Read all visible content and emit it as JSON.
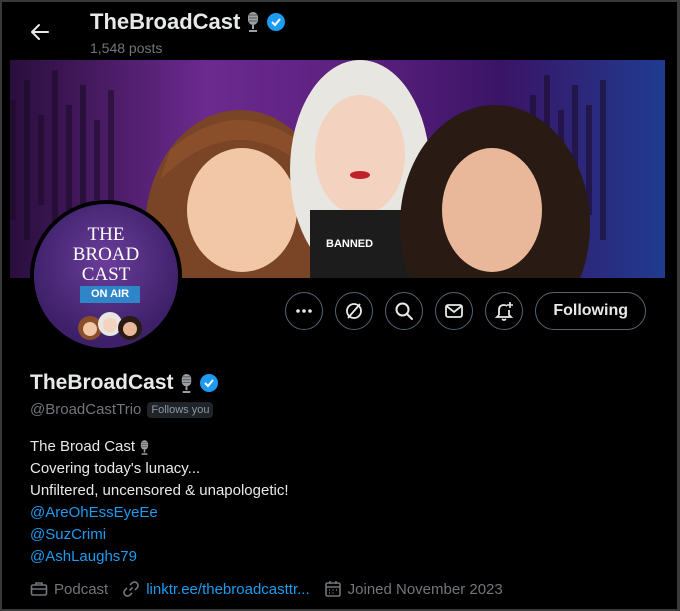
{
  "header": {
    "title": "TheBroadCast",
    "posts": "1,548 posts"
  },
  "banner": {
    "badge_text": "BANNED"
  },
  "avatar": {
    "line1": "THE",
    "line2": "BROAD",
    "line3": "CAST",
    "on_air": "ON AIR"
  },
  "actions": {
    "following_label": "Following"
  },
  "profile": {
    "name": "TheBroadCast",
    "handle": "@BroadCastTrio",
    "follows_you": "Follows you",
    "bio": {
      "line1": "The Broad Cast",
      "line2": "Covering today's lunacy...",
      "line3": "Unfiltered, uncensored & unapologetic!",
      "mentions": [
        "@AreOhEssEyeEe",
        "@SuzCrimi",
        "@AshLaughs79"
      ]
    },
    "meta": {
      "category": "Podcast",
      "link": "linktr.ee/thebroadcasttr...",
      "joined": "Joined November 2023"
    }
  },
  "colors": {
    "accent": "#1d9bf0",
    "verified": "#1d9bf0",
    "muted": "#71767b"
  },
  "icons": [
    "back-arrow-icon",
    "microphone-icon",
    "verified-badge-icon",
    "more-icon",
    "grok-icon",
    "search-icon",
    "message-icon",
    "notify-icon",
    "briefcase-icon",
    "link-icon",
    "calendar-icon"
  ]
}
